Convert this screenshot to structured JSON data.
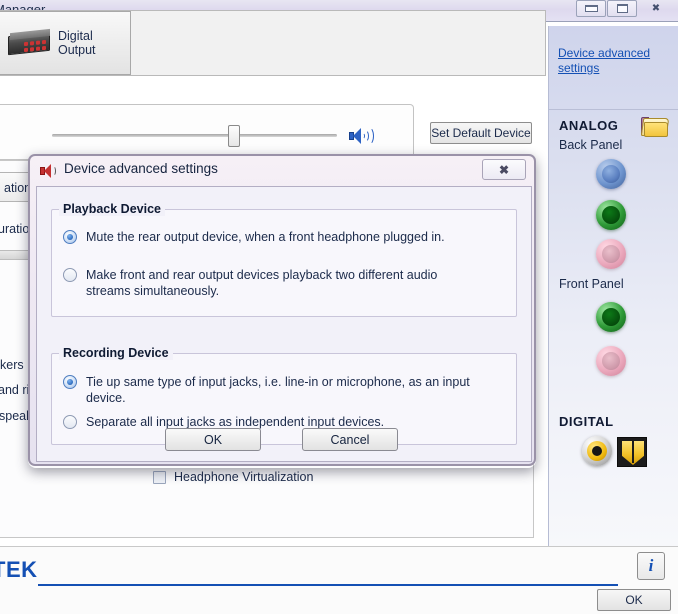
{
  "window": {
    "title": "Manager",
    "minimize_label": "minimize",
    "maximize_label": "maximize",
    "close_label": "✖"
  },
  "device_tab": {
    "label": "Digital Output",
    "icon": "audio-device-icon"
  },
  "volume": {
    "speaker_icon": "speaker-volume-icon",
    "slider_value": "62"
  },
  "set_default": {
    "label": "Set Default Device"
  },
  "behind": {
    "text1": "ation",
    "text2": "uration",
    "text3": "kers",
    "text4": "and rig",
    "text5": "speake"
  },
  "headphone_virtualization": {
    "label": "Headphone Virtualization",
    "checked": false
  },
  "sidebar": {
    "advanced_link": "Device advanced settings",
    "folder_icon": "folder-icon",
    "analog_heading": "ANALOG",
    "back_panel_label": "Back Panel",
    "front_panel_label": "Front Panel",
    "digital_heading": "DIGITAL",
    "back_panel_jacks": [
      {
        "name": "jack-line-in-blue",
        "color": "#6f95cf",
        "type": "blue",
        "active": false
      },
      {
        "name": "jack-line-out-green",
        "color": "#2f9b38",
        "type": "green",
        "active": true
      },
      {
        "name": "jack-mic-in-pink",
        "color": "#eba9bd",
        "type": "pink",
        "active": false
      }
    ],
    "front_panel_jacks": [
      {
        "name": "jack-front-out-green",
        "color": "#2f9b38",
        "type": "green",
        "active": true
      },
      {
        "name": "jack-front-mic-pink",
        "color": "#eba9bd",
        "type": "pink",
        "active": false
      }
    ],
    "digital_jacks": [
      {
        "name": "jack-coaxial-spdif",
        "color": "#f0b90d"
      },
      {
        "name": "jack-optical-spdif",
        "color": "#f3c229"
      }
    ]
  },
  "footer": {
    "brand": "TEK",
    "info_label": "i",
    "ok_label": "OK"
  },
  "dialog": {
    "title": "Device advanced settings",
    "icon": "speaker-icon",
    "close_label": "✖",
    "playback_group": {
      "title": "Playback Device",
      "options": [
        {
          "label": "Mute the rear output device, when a front headphone plugged in.",
          "selected": true
        },
        {
          "label": "Make front and rear output devices playback two different audio streams simultaneously.",
          "selected": false
        }
      ]
    },
    "recording_group": {
      "title": "Recording Device",
      "options": [
        {
          "label": "Tie up same type of input jacks, i.e. line-in or microphone, as an input device.",
          "selected": true
        },
        {
          "label": "Separate all input jacks as independent input devices.",
          "selected": false
        }
      ]
    },
    "ok_label": "OK",
    "cancel_label": "Cancel"
  }
}
